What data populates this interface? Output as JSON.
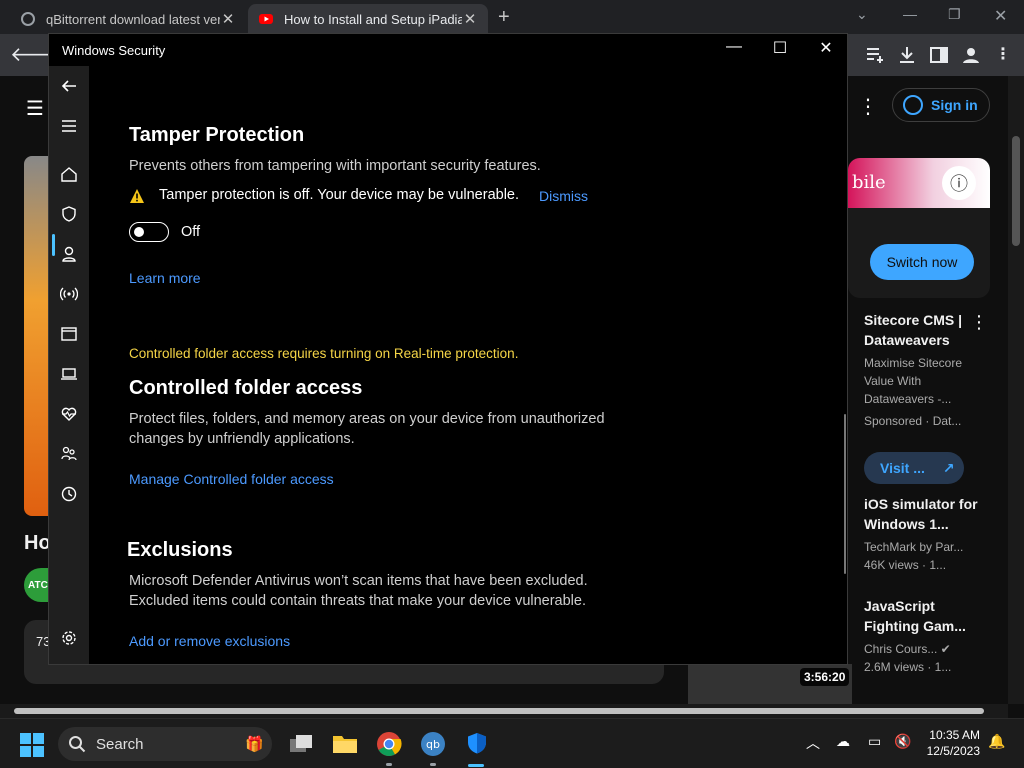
{
  "browser": {
    "tabs": [
      {
        "title": "qBittorrent download latest vers",
        "close": "✕"
      },
      {
        "title": "How to Install and Setup iPadian",
        "close": "✕"
      }
    ],
    "new_tab": "+"
  },
  "youtube": {
    "sign_in": "Sign in",
    "ad": {
      "image_text": "bile",
      "cta": "Switch now"
    },
    "sidebar": [
      {
        "title": "Sitecore CMS | Dataweavers",
        "line1": "Maximise Sitecore Value With Dataweavers -...",
        "line2": "Sponsored · Dat..."
      },
      {
        "title": "iOS simulator for Windows 1...",
        "line1": "TechMark by Par...",
        "line2": "46K views · 1..."
      },
      {
        "title": "JavaScript Fighting Gam...",
        "line1": "Chris Cours... ✔",
        "line2": "2.6M views · 1..."
      }
    ],
    "visit_label": "Visit ...",
    "left_title_fragment": "Ho",
    "left_avatar_text": "ATC",
    "left_desc_fragment": "73",
    "duration": "3:56:20"
  },
  "security": {
    "window_title": "Windows Security",
    "tamper": {
      "heading": "Tamper Protection",
      "description": "Prevents others from tampering with important security features.",
      "warning": "Tamper protection is off. Your device may be vulnerable.",
      "dismiss": "Dismiss",
      "toggle_state": "Off",
      "learn_more": "Learn more"
    },
    "cfa": {
      "notice": "Controlled folder access requires turning on Real-time protection.",
      "heading": "Controlled folder access",
      "description_1": "Protect files, folders, and memory areas on your device from unauthorized",
      "description_2": "changes by unfriendly applications.",
      "link": "Manage Controlled folder access"
    },
    "exclusions": {
      "heading": "Exclusions",
      "description_1": "Microsoft Defender Antivirus won’t scan items that have been excluded.",
      "description_2": "Excluded items could contain threats that make your device vulnerable.",
      "link": "Add or remove exclusions"
    },
    "nav_icons": [
      "back-icon",
      "menu-icon",
      "home-icon",
      "shield-icon",
      "account-icon",
      "firewall-icon",
      "app-browser-icon",
      "device-security-icon",
      "health-icon",
      "family-icon",
      "history-icon",
      "settings-icon"
    ]
  },
  "taskbar": {
    "search_label": "Search",
    "time": "10:35 AM",
    "date": "12/5/2023"
  },
  "colors": {
    "accent": "#4cc2ff",
    "link": "#4c9aff",
    "warning_text": "#f5d547",
    "youtube_blue": "#3ea6ff"
  }
}
